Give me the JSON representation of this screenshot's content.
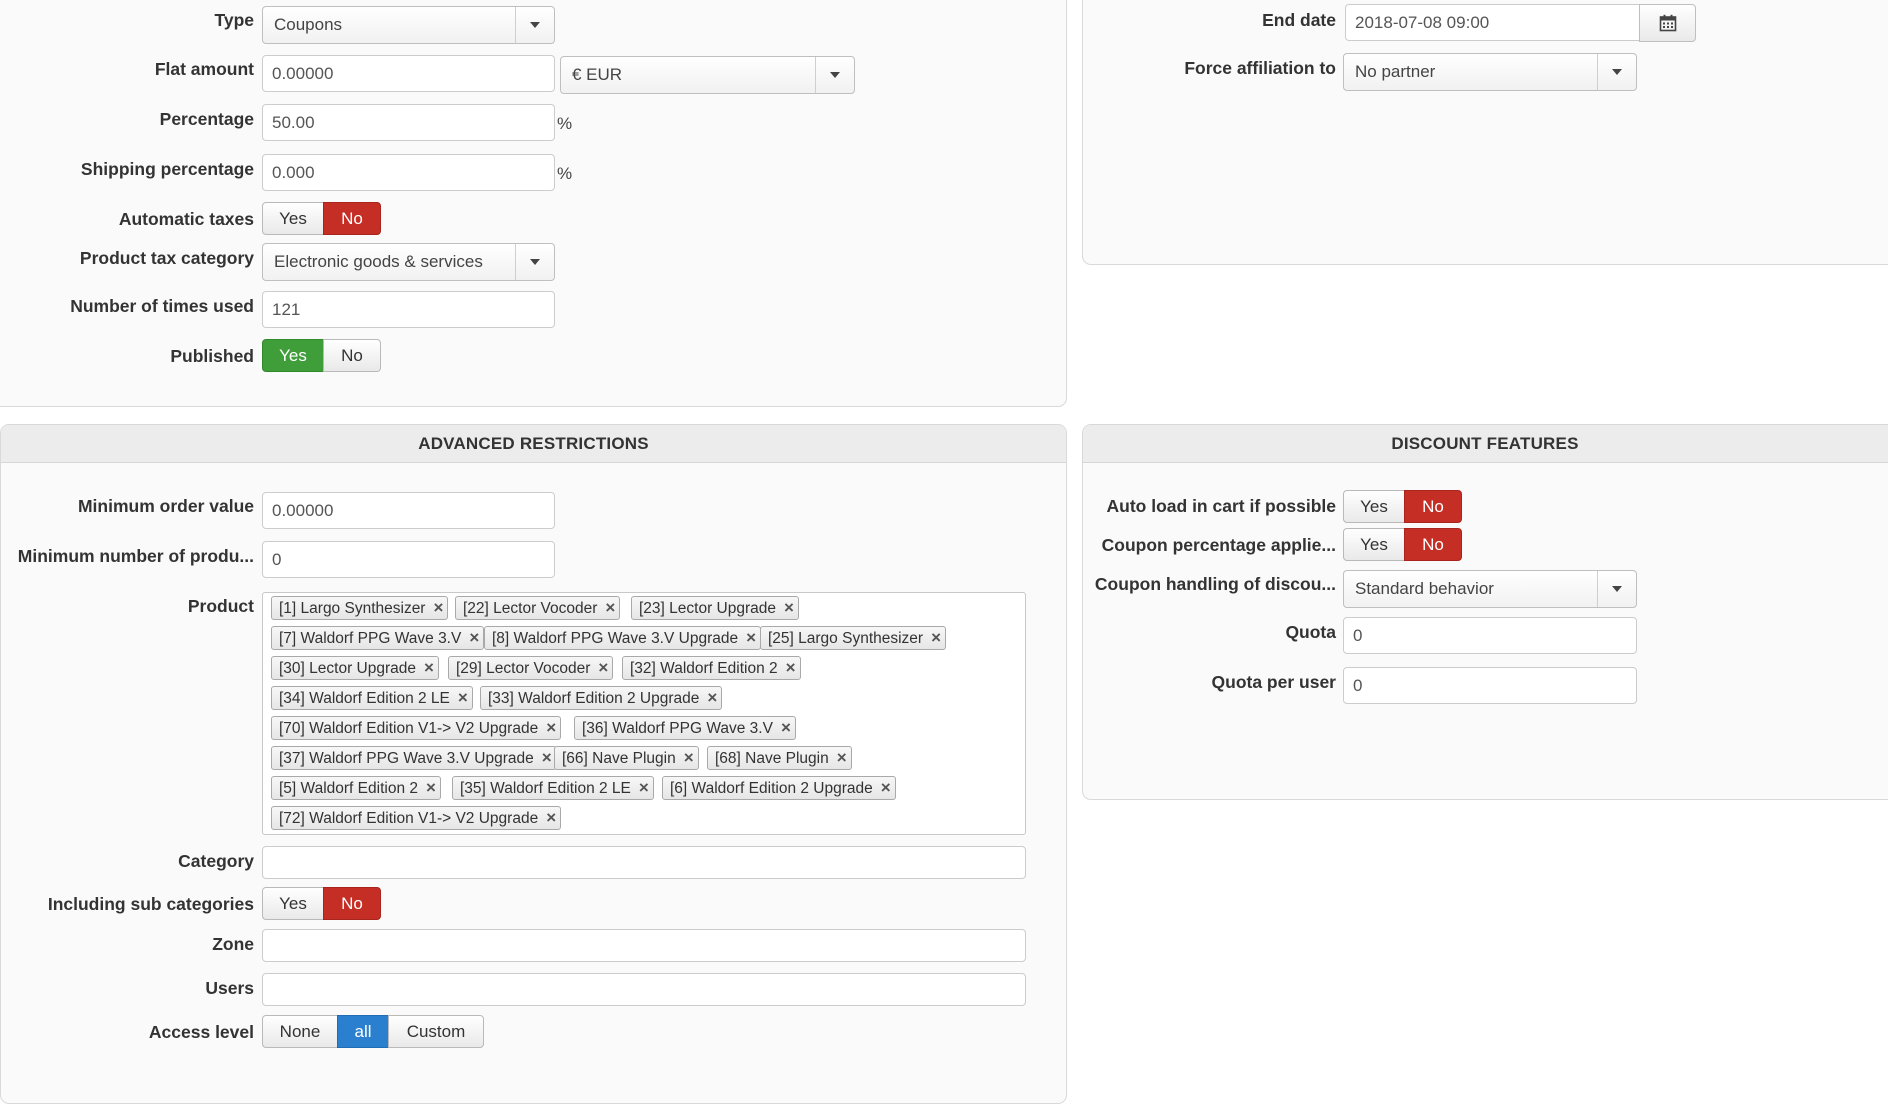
{
  "general": {
    "type": {
      "label": "Type",
      "value": "Coupons"
    },
    "flat_amount": {
      "label": "Flat amount",
      "value": "0.00000",
      "currency": "€ EUR"
    },
    "percentage": {
      "label": "Percentage",
      "value": "50.00",
      "unit": "%"
    },
    "shipping_percentage": {
      "label": "Shipping percentage",
      "value": "0.000",
      "unit": "%"
    },
    "automatic_taxes": {
      "label": "Automatic taxes",
      "yes": "Yes",
      "no": "No",
      "selected": "No"
    },
    "product_tax_category": {
      "label": "Product tax category",
      "value": "Electronic goods & services"
    },
    "times_used": {
      "label": "Number of times used",
      "value": "121"
    },
    "published": {
      "label": "Published",
      "yes": "Yes",
      "no": "No",
      "selected": "Yes"
    }
  },
  "dates": {
    "end_date": {
      "label": "End date",
      "value": "2018-07-08 09:00"
    },
    "force_affiliation": {
      "label": "Force affiliation to",
      "value": "No partner"
    }
  },
  "advanced": {
    "title": "ADVANCED RESTRICTIONS",
    "min_order_value": {
      "label": "Minimum order value",
      "value": "0.00000"
    },
    "min_products": {
      "label": "Minimum number of produ...",
      "value": "0"
    },
    "product": {
      "label": "Product",
      "tags": [
        "[1] Largo Synthesizer",
        "[22] Lector Vocoder",
        "[23] Lector Upgrade",
        "[7] Waldorf PPG Wave 3.V",
        "[8] Waldorf PPG Wave 3.V Upgrade",
        "[25] Largo Synthesizer",
        "[30] Lector Upgrade",
        "[29] Lector Vocoder",
        "[32] Waldorf Edition 2",
        "[34] Waldorf Edition 2 LE",
        "[33] Waldorf Edition 2 Upgrade",
        "[70] Waldorf Edition V1-> V2 Upgrade",
        "[36] Waldorf PPG Wave 3.V",
        "[37] Waldorf PPG Wave 3.V Upgrade",
        "[66] Nave Plugin",
        "[68] Nave Plugin",
        "[5] Waldorf Edition 2",
        "[35] Waldorf Edition 2 LE",
        "[6] Waldorf Edition 2 Upgrade",
        "[72] Waldorf Edition V1-> V2 Upgrade"
      ]
    },
    "category": {
      "label": "Category",
      "value": ""
    },
    "sub_categories": {
      "label": "Including sub categories",
      "yes": "Yes",
      "no": "No",
      "selected": "No"
    },
    "zone": {
      "label": "Zone",
      "value": ""
    },
    "users": {
      "label": "Users",
      "value": ""
    },
    "access_level": {
      "label": "Access level",
      "none": "None",
      "all": "all",
      "custom": "Custom",
      "selected": "all"
    }
  },
  "discount": {
    "title": "DISCOUNT FEATURES",
    "auto_load": {
      "label": "Auto load in cart if possible",
      "yes": "Yes",
      "no": "No",
      "selected": "No"
    },
    "coupon_percentage": {
      "label": "Coupon percentage applie...",
      "yes": "Yes",
      "no": "No",
      "selected": "No"
    },
    "coupon_handling": {
      "label": "Coupon handling of discou...",
      "value": "Standard behavior"
    },
    "quota": {
      "label": "Quota",
      "value": "0"
    },
    "quota_per_user": {
      "label": "Quota per user",
      "value": "0"
    }
  },
  "colors": {
    "no_active": "#c52e25",
    "yes_active": "#3f9d3a",
    "all_active": "#2a7fce"
  },
  "icons": {
    "calendar": "calendar-icon",
    "dropdown": "chevron-down-icon",
    "remove": "close-icon"
  }
}
